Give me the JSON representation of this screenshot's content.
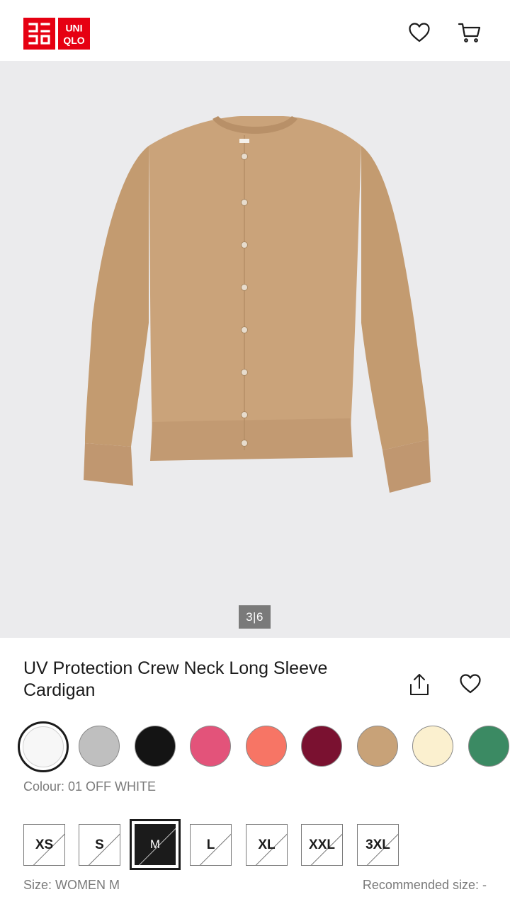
{
  "header": {
    "logo_text_top": "UNI",
    "logo_text_bottom": "QLO",
    "icons": [
      "heart-icon",
      "cart-icon"
    ]
  },
  "gallery": {
    "counter_current": "3",
    "counter_separator": "|",
    "counter_total": "6"
  },
  "product": {
    "title": "UV Protection Crew Neck Long Sleeve Cardigan",
    "icons": [
      "share-icon",
      "heart-icon"
    ]
  },
  "colours": {
    "label": "Colour: 01 OFF WHITE",
    "swatches": [
      {
        "name": "off-white",
        "hex": "#f7f7f7",
        "selected": true
      },
      {
        "name": "gray",
        "hex": "#bfbfbf"
      },
      {
        "name": "black",
        "hex": "#141414"
      },
      {
        "name": "pink",
        "hex": "#e3537a"
      },
      {
        "name": "coral",
        "hex": "#f77565"
      },
      {
        "name": "wine",
        "hex": "#7a1130"
      },
      {
        "name": "beige",
        "hex": "#c8a278"
      },
      {
        "name": "cream",
        "hex": "#fbf0cf"
      },
      {
        "name": "green",
        "hex": "#3b8a63"
      }
    ]
  },
  "sizes": {
    "options": [
      "XS",
      "S",
      "M",
      "L",
      "XL",
      "XXL",
      "3XL"
    ],
    "selected": "M",
    "label": "Size: WOMEN M",
    "recommended": "Recommended size: -"
  },
  "colors": {
    "brand": "#e60012",
    "hero_bg": "#ebebed",
    "cardigan": "#c8a278"
  }
}
